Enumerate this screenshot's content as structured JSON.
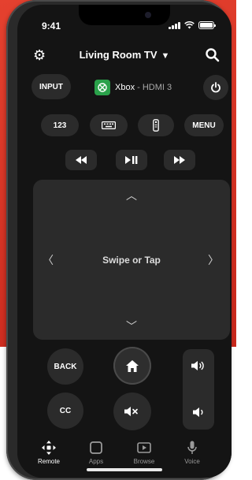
{
  "status_bar": {
    "time": "9:41"
  },
  "header": {
    "device_name": "Living Room TV"
  },
  "source": {
    "name": "Xbox",
    "separator": " - ",
    "input": "HDMI 3"
  },
  "buttons": {
    "input": "INPUT",
    "numbers": "123",
    "menu": "MENU",
    "back": "BACK",
    "cc": "CC"
  },
  "trackpad": {
    "label": "Swipe or Tap"
  },
  "tabs": [
    {
      "label": "Remote",
      "icon": "dpad-icon",
      "active": true
    },
    {
      "label": "Apps",
      "icon": "apps-icon",
      "active": false
    },
    {
      "label": "Browse",
      "icon": "play-icon",
      "active": false
    },
    {
      "label": "Voice",
      "icon": "mic-icon",
      "active": false
    }
  ],
  "colors": {
    "background_red": "#d8331f",
    "screen": "#141414",
    "button": "#2b2b2b",
    "xbox_green": "#2aa14a"
  }
}
